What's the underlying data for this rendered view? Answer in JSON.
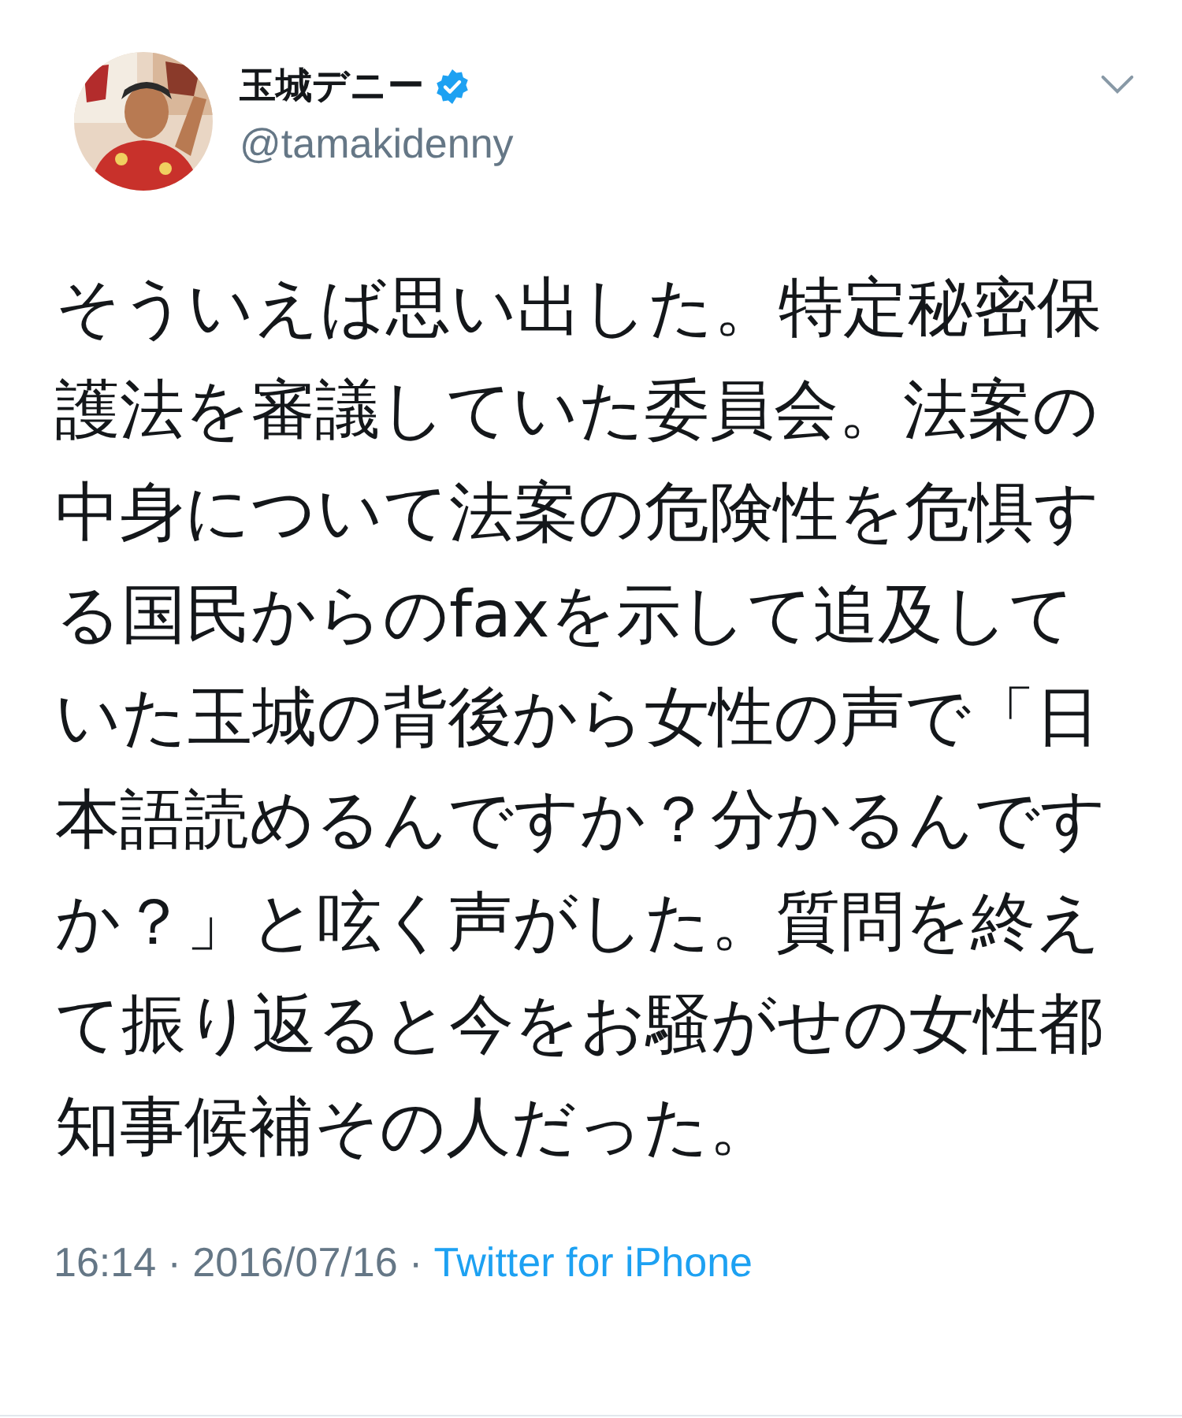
{
  "tweet": {
    "author": {
      "name": "玉城デニー",
      "handle": "@tamakidenny",
      "verified": true
    },
    "text": "そういえば思い出した。特定秘密保護法を審議していた委員会。法案の中身について法案の危険性を危惧する国民からのfaxを示して追及していた玉城の背後から女性の声で「日本語読めるんですか？分かるんですか？」と呟く声がした。質問を終えて振り返ると今をお騒がせの女性都知事候補その人だった。",
    "timestamp": "16:14 · 2016/07/16 ·",
    "source": "Twitter for iPhone"
  }
}
